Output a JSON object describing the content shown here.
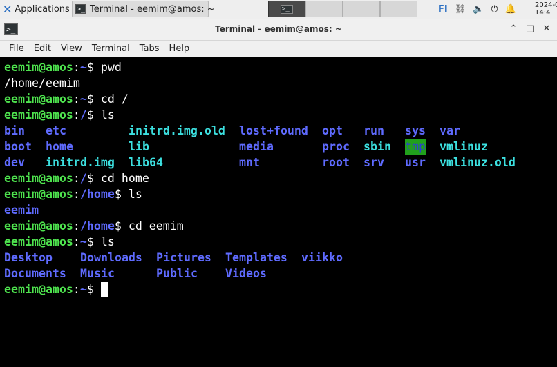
{
  "panel": {
    "applications_label": "Applications",
    "task_label": "Terminal - eemim@amos: ~",
    "keyboard_layout": "FI",
    "clock_date": "2024-0",
    "clock_time": "14:4"
  },
  "window": {
    "title": "Terminal - eemim@amos: ~",
    "menu": [
      "File",
      "Edit",
      "View",
      "Terminal",
      "Tabs",
      "Help"
    ]
  },
  "terminal": {
    "user_host": "eemim@amos",
    "l1_dir": "~",
    "l1_cmd": "$ pwd",
    "l2_out": "/home/eemim",
    "l3_dir": "~",
    "l3_cmd": "$ cd /",
    "l4_dir": "/",
    "l4_cmd": "$ ls",
    "ls_root": [
      [
        "bin",
        "etc",
        "initrd.img.old",
        "lost+found",
        "opt",
        "run",
        "sys",
        "var"
      ],
      [
        "boot",
        "home",
        "lib",
        "media",
        "proc",
        "sbin",
        "tmp",
        "vmlinuz"
      ],
      [
        "dev",
        "initrd.img",
        "lib64",
        "mnt",
        "root",
        "srv",
        "usr",
        "vmlinuz.old"
      ]
    ],
    "l8_dir": "/",
    "l8_cmd": "$ cd home",
    "l9_dir": "/home",
    "l9_cmd": "$ ls",
    "l10_out": "eemim",
    "l11_dir": "/home",
    "l11_cmd": "$ cd eemim",
    "l12_dir": "~",
    "l12_cmd": "$ ls",
    "ls_home": [
      [
        "Desktop",
        "Downloads",
        "Pictures",
        "Templates",
        "viikko"
      ],
      [
        "Documents",
        "Music",
        "Public",
        "Videos"
      ]
    ],
    "l15_dir": "~",
    "l15_cmd": "$ "
  },
  "colors": {
    "prompt_user": "#4ee34e",
    "directory": "#5f6bff",
    "symlink": "#3ce0e0",
    "sticky_dir_bg": "#21a01c",
    "terminal_bg": "#000000"
  }
}
